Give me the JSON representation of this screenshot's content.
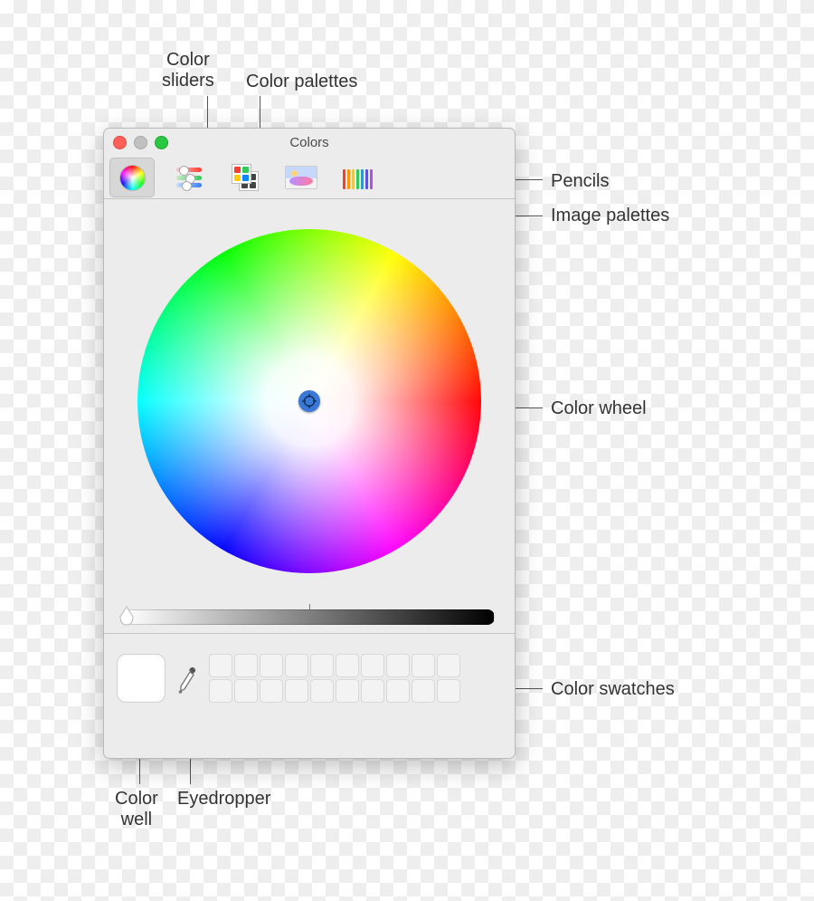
{
  "window": {
    "title": "Colors"
  },
  "toolbar": {
    "tabs": [
      {
        "id": "wheel",
        "name": "color-wheel-tab",
        "selected": true
      },
      {
        "id": "sliders",
        "name": "color-sliders-tab",
        "selected": false
      },
      {
        "id": "palettes",
        "name": "color-palettes-tab",
        "selected": false
      },
      {
        "id": "image",
        "name": "image-palettes-tab",
        "selected": false
      },
      {
        "id": "pencils",
        "name": "pencils-tab",
        "selected": false
      }
    ]
  },
  "swatches": {
    "rows": 2,
    "cols": 10
  },
  "pencil_colors": [
    "#ff3b30",
    "#ff9500",
    "#ffcc00",
    "#34c759",
    "#00a5ff",
    "#5856d6",
    "#af52de"
  ],
  "annotations": {
    "color_sliders": "Color sliders",
    "color_palettes": "Color palettes",
    "pencils": "Pencils",
    "image_palettes": "Image palettes",
    "color_wheel": "Color wheel",
    "color_swatches": "Color swatches",
    "color_well_l1": "Color",
    "color_well_l2": "well",
    "eyedropper": "Eyedropper"
  }
}
